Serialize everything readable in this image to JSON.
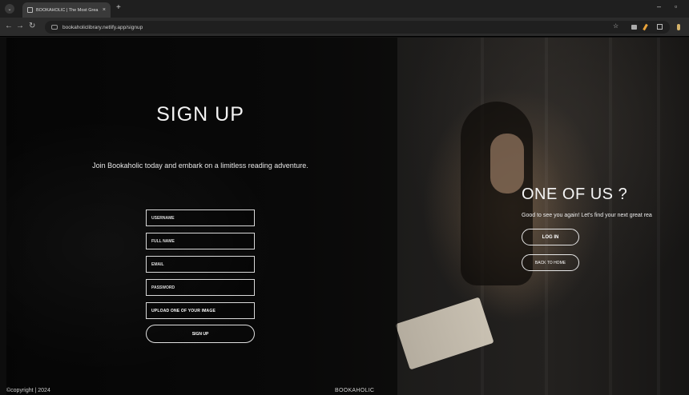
{
  "browser": {
    "tab_title": "BOOKAHOLIC | The Most Grea",
    "tab_close": "×",
    "new_tab": "+",
    "menu_glyph": "⌄",
    "minimize": "–",
    "maximize": "▫",
    "url": "bookaholiclibrary.netlify.app/signup",
    "back": "←",
    "forward": "→",
    "reload": "↻",
    "star": "☆"
  },
  "signup": {
    "title": "SIGN UP",
    "subtitle": "Join Bookaholic today and embark on a limitless reading adventure.",
    "username_placeholder": "USERNAME",
    "fullname_placeholder": "FULL NAME",
    "email_placeholder": "EMAIL",
    "password_placeholder": "PASSWORD",
    "upload_label": "UPLOAD ONE OF YOUR IMAGE",
    "submit_label": "SIGN UP"
  },
  "login_panel": {
    "title": "ONE OF US ?",
    "subtitle": "Good to see you again! Let's find your next great rea",
    "login_label": "LOG IN",
    "home_label": "BACK TO HOME"
  },
  "footer": {
    "copyright": "©copyright | 2024",
    "brand": "BOOKAHOLIC"
  },
  "colors": {
    "accent": "#ffffff",
    "background": "#111111",
    "chrome": "#2b2b2b"
  }
}
